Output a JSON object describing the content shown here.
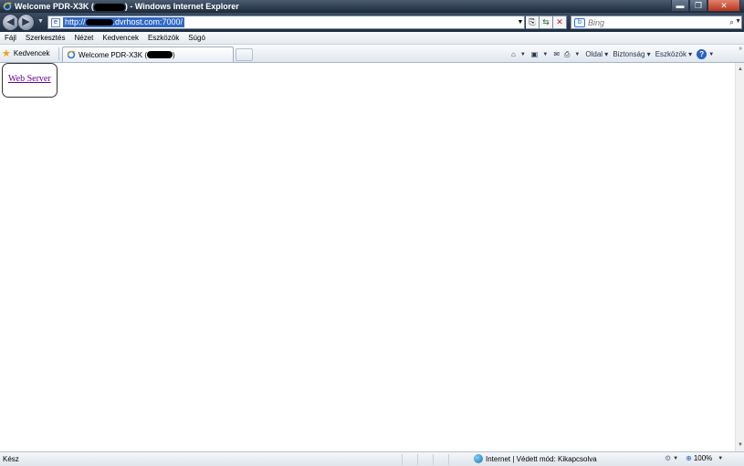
{
  "window": {
    "title_prefix": "Welcome PDR-X3K (",
    "title_suffix": ") - Windows Internet Explorer",
    "minimize_glyph": "▬",
    "maximize_glyph": "❐",
    "close_glyph": "✕"
  },
  "address": {
    "url_prefix": "http://",
    "url_suffix": ".dvrhost.com:7000/",
    "search_placeholder": "Bing"
  },
  "menu": {
    "items": [
      "Fájl",
      "Szerkesztés",
      "Nézet",
      "Kedvencek",
      "Eszközök",
      "Súgó"
    ]
  },
  "favorites": {
    "label": "Kedvencek"
  },
  "tab": {
    "title_prefix": "Welcome PDR-X3K (",
    "title_suffix": ")"
  },
  "command_bar": {
    "page_label": "Oldal",
    "safety_label": "Biztonság",
    "tools_label": "Eszközök"
  },
  "content": {
    "link_text": "Web Server"
  },
  "status": {
    "text": "Kész",
    "zone": "Internet | Védett mód: Kikapcsolva",
    "zoom": "100%"
  },
  "colors": {
    "link_visited": "#660099",
    "url_highlight": "#316ac5"
  }
}
